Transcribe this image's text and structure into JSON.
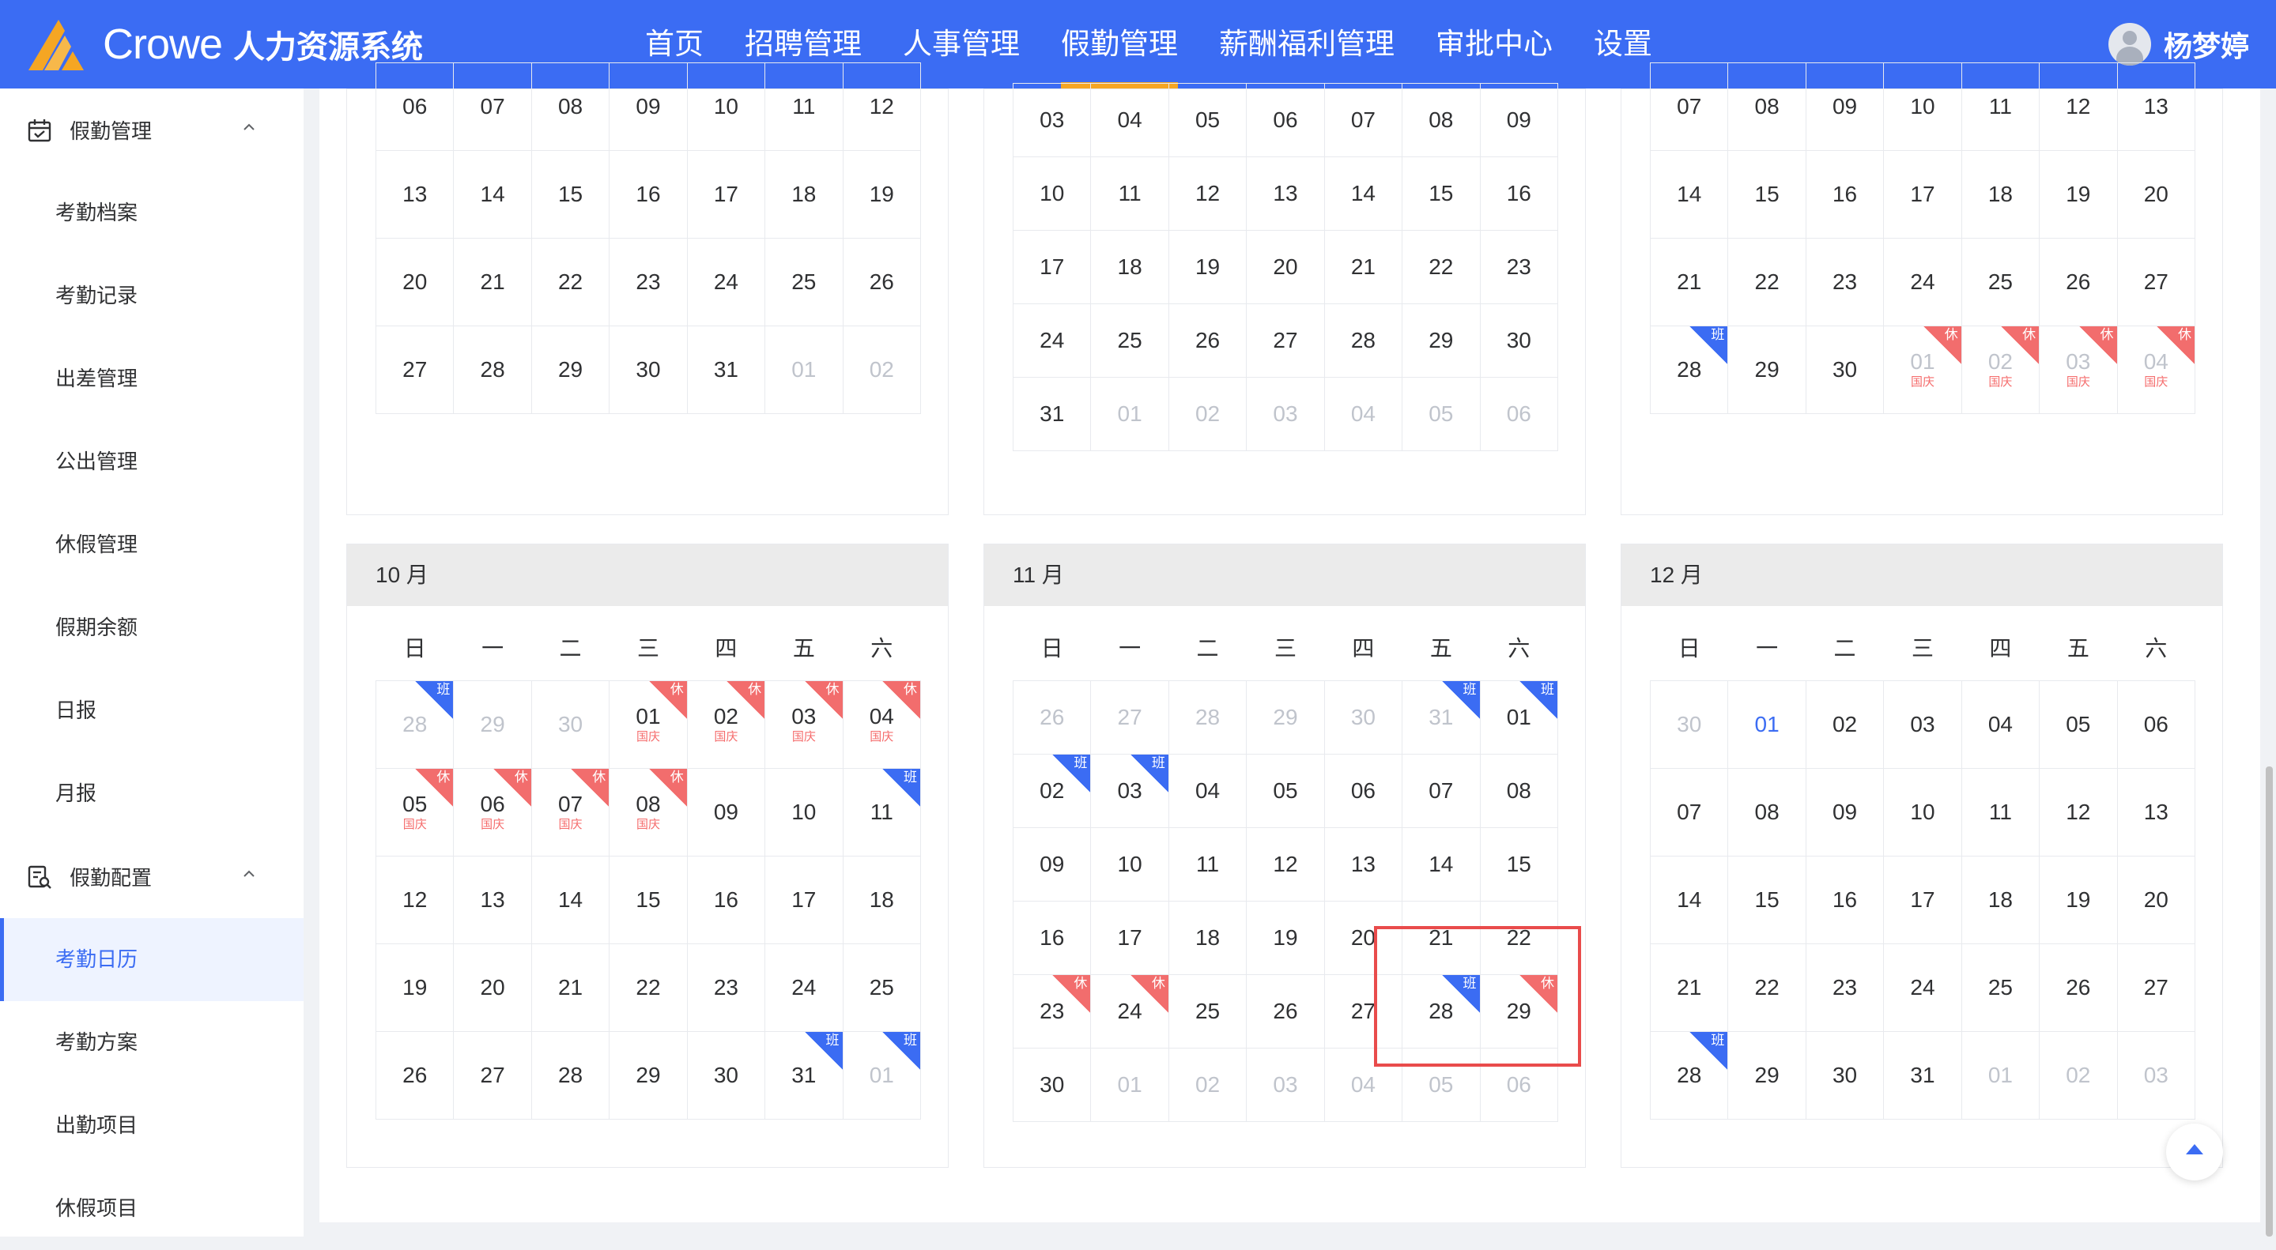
{
  "header": {
    "brand": "Crowe",
    "system_name": "人力资源系统",
    "nav": [
      "首页",
      "招聘管理",
      "人事管理",
      "假勤管理",
      "薪酬福利管理",
      "审批中心",
      "设置"
    ],
    "active_nav": 3,
    "user_name": "杨梦婷"
  },
  "sidebar": {
    "groups": [
      {
        "label": "假勤管理",
        "icon": "calendar-icon",
        "items": [
          "考勤档案",
          "考勤记录",
          "出差管理",
          "公出管理",
          "休假管理",
          "假期余额",
          "日报",
          "月报"
        ]
      },
      {
        "label": "假勤配置",
        "icon": "config-search-icon",
        "items": [
          "考勤日历",
          "考勤方案",
          "出勤项目",
          "休假项目"
        ]
      }
    ],
    "active_item": "考勤日历"
  },
  "calendar": {
    "weekdays": [
      "日",
      "一",
      "二",
      "三",
      "四",
      "五",
      "六"
    ],
    "tags": {
      "rest": "休",
      "work": "班"
    },
    "holiday_label": "国庆",
    "months": [
      {
        "label": "",
        "rows": [
          [
            {
              "d": "06"
            },
            {
              "d": "07"
            },
            {
              "d": "08"
            },
            {
              "d": "09"
            },
            {
              "d": "10"
            },
            {
              "d": "11"
            },
            {
              "d": "12"
            }
          ],
          [
            {
              "d": "13"
            },
            {
              "d": "14"
            },
            {
              "d": "15"
            },
            {
              "d": "16"
            },
            {
              "d": "17"
            },
            {
              "d": "18"
            },
            {
              "d": "19"
            }
          ],
          [
            {
              "d": "20"
            },
            {
              "d": "21"
            },
            {
              "d": "22"
            },
            {
              "d": "23"
            },
            {
              "d": "24"
            },
            {
              "d": "25"
            },
            {
              "d": "26"
            }
          ],
          [
            {
              "d": "27"
            },
            {
              "d": "28"
            },
            {
              "d": "29"
            },
            {
              "d": "30"
            },
            {
              "d": "31"
            },
            {
              "d": "01",
              "g": 1
            },
            {
              "d": "02",
              "g": 1
            }
          ]
        ]
      },
      {
        "label": "",
        "rows": [
          [
            {
              "d": "03"
            },
            {
              "d": "04"
            },
            {
              "d": "05"
            },
            {
              "d": "06"
            },
            {
              "d": "07"
            },
            {
              "d": "08"
            },
            {
              "d": "09"
            }
          ],
          [
            {
              "d": "10"
            },
            {
              "d": "11"
            },
            {
              "d": "12"
            },
            {
              "d": "13"
            },
            {
              "d": "14"
            },
            {
              "d": "15"
            },
            {
              "d": "16"
            }
          ],
          [
            {
              "d": "17"
            },
            {
              "d": "18"
            },
            {
              "d": "19"
            },
            {
              "d": "20"
            },
            {
              "d": "21"
            },
            {
              "d": "22"
            },
            {
              "d": "23"
            }
          ],
          [
            {
              "d": "24"
            },
            {
              "d": "25"
            },
            {
              "d": "26"
            },
            {
              "d": "27"
            },
            {
              "d": "28"
            },
            {
              "d": "29"
            },
            {
              "d": "30"
            }
          ],
          [
            {
              "d": "31"
            },
            {
              "d": "01",
              "g": 1
            },
            {
              "d": "02",
              "g": 1
            },
            {
              "d": "03",
              "g": 1
            },
            {
              "d": "04",
              "g": 1
            },
            {
              "d": "05",
              "g": 1
            },
            {
              "d": "06",
              "g": 1
            }
          ]
        ]
      },
      {
        "label": "",
        "rows": [
          [
            {
              "d": "07"
            },
            {
              "d": "08"
            },
            {
              "d": "09"
            },
            {
              "d": "10"
            },
            {
              "d": "11"
            },
            {
              "d": "12"
            },
            {
              "d": "13"
            }
          ],
          [
            {
              "d": "14"
            },
            {
              "d": "15"
            },
            {
              "d": "16"
            },
            {
              "d": "17"
            },
            {
              "d": "18"
            },
            {
              "d": "19"
            },
            {
              "d": "20"
            }
          ],
          [
            {
              "d": "21"
            },
            {
              "d": "22"
            },
            {
              "d": "23"
            },
            {
              "d": "24"
            },
            {
              "d": "25"
            },
            {
              "d": "26"
            },
            {
              "d": "27"
            }
          ],
          [
            {
              "d": "28",
              "t": "work"
            },
            {
              "d": "29"
            },
            {
              "d": "30"
            },
            {
              "d": "01",
              "g": 1,
              "t": "rest",
              "h": 1
            },
            {
              "d": "02",
              "g": 1,
              "t": "rest",
              "h": 1
            },
            {
              "d": "03",
              "g": 1,
              "t": "rest",
              "h": 1
            },
            {
              "d": "04",
              "g": 1,
              "t": "rest",
              "h": 1
            }
          ]
        ]
      },
      {
        "label": "10 月",
        "rows": [
          [
            {
              "d": "28",
              "g": 1,
              "t": "work"
            },
            {
              "d": "29",
              "g": 1
            },
            {
              "d": "30",
              "g": 1
            },
            {
              "d": "01",
              "t": "rest",
              "h": 1
            },
            {
              "d": "02",
              "t": "rest",
              "h": 1
            },
            {
              "d": "03",
              "t": "rest",
              "h": 1
            },
            {
              "d": "04",
              "t": "rest",
              "h": 1
            }
          ],
          [
            {
              "d": "05",
              "t": "rest",
              "h": 1
            },
            {
              "d": "06",
              "t": "rest",
              "h": 1
            },
            {
              "d": "07",
              "t": "rest",
              "h": 1
            },
            {
              "d": "08",
              "t": "rest",
              "h": 1
            },
            {
              "d": "09"
            },
            {
              "d": "10"
            },
            {
              "d": "11",
              "t": "work"
            }
          ],
          [
            {
              "d": "12"
            },
            {
              "d": "13"
            },
            {
              "d": "14"
            },
            {
              "d": "15"
            },
            {
              "d": "16"
            },
            {
              "d": "17"
            },
            {
              "d": "18"
            }
          ],
          [
            {
              "d": "19"
            },
            {
              "d": "20"
            },
            {
              "d": "21"
            },
            {
              "d": "22"
            },
            {
              "d": "23"
            },
            {
              "d": "24"
            },
            {
              "d": "25"
            }
          ],
          [
            {
              "d": "26"
            },
            {
              "d": "27"
            },
            {
              "d": "28"
            },
            {
              "d": "29"
            },
            {
              "d": "30"
            },
            {
              "d": "31",
              "t": "work"
            },
            {
              "d": "01",
              "g": 1,
              "t": "work"
            }
          ]
        ]
      },
      {
        "label": "11 月",
        "rows": [
          [
            {
              "d": "26",
              "g": 1
            },
            {
              "d": "27",
              "g": 1
            },
            {
              "d": "28",
              "g": 1
            },
            {
              "d": "29",
              "g": 1
            },
            {
              "d": "30",
              "g": 1
            },
            {
              "d": "31",
              "g": 1,
              "t": "work"
            },
            {
              "d": "01",
              "t": "work"
            }
          ],
          [
            {
              "d": "02",
              "t": "work"
            },
            {
              "d": "03",
              "t": "work"
            },
            {
              "d": "04"
            },
            {
              "d": "05"
            },
            {
              "d": "06"
            },
            {
              "d": "07"
            },
            {
              "d": "08"
            }
          ],
          [
            {
              "d": "09"
            },
            {
              "d": "10"
            },
            {
              "d": "11"
            },
            {
              "d": "12"
            },
            {
              "d": "13"
            },
            {
              "d": "14"
            },
            {
              "d": "15"
            }
          ],
          [
            {
              "d": "16"
            },
            {
              "d": "17"
            },
            {
              "d": "18"
            },
            {
              "d": "19"
            },
            {
              "d": "20"
            },
            {
              "d": "21"
            },
            {
              "d": "22"
            }
          ],
          [
            {
              "d": "23",
              "t": "rest"
            },
            {
              "d": "24",
              "t": "rest"
            },
            {
              "d": "25"
            },
            {
              "d": "26"
            },
            {
              "d": "27"
            },
            {
              "d": "28",
              "t": "work"
            },
            {
              "d": "29",
              "t": "rest"
            }
          ],
          [
            {
              "d": "30"
            },
            {
              "d": "01",
              "g": 1
            },
            {
              "d": "02",
              "g": 1
            },
            {
              "d": "03",
              "g": 1
            },
            {
              "d": "04",
              "g": 1
            },
            {
              "d": "05",
              "g": 1
            },
            {
              "d": "06",
              "g": 1
            }
          ]
        ]
      },
      {
        "label": "12 月",
        "rows": [
          [
            {
              "d": "30",
              "g": 1
            },
            {
              "d": "01",
              "today": 1
            },
            {
              "d": "02"
            },
            {
              "d": "03"
            },
            {
              "d": "04"
            },
            {
              "d": "05"
            },
            {
              "d": "06"
            }
          ],
          [
            {
              "d": "07"
            },
            {
              "d": "08"
            },
            {
              "d": "09"
            },
            {
              "d": "10"
            },
            {
              "d": "11"
            },
            {
              "d": "12"
            },
            {
              "d": "13"
            }
          ],
          [
            {
              "d": "14"
            },
            {
              "d": "15"
            },
            {
              "d": "16"
            },
            {
              "d": "17"
            },
            {
              "d": "18"
            },
            {
              "d": "19"
            },
            {
              "d": "20"
            }
          ],
          [
            {
              "d": "21"
            },
            {
              "d": "22"
            },
            {
              "d": "23"
            },
            {
              "d": "24"
            },
            {
              "d": "25"
            },
            {
              "d": "26"
            },
            {
              "d": "27"
            }
          ],
          [
            {
              "d": "28",
              "t": "work"
            },
            {
              "d": "29"
            },
            {
              "d": "30"
            },
            {
              "d": "31"
            },
            {
              "d": "01",
              "g": 1
            },
            {
              "d": "02",
              "g": 1
            },
            {
              "d": "03",
              "g": 1
            }
          ]
        ]
      }
    ]
  }
}
